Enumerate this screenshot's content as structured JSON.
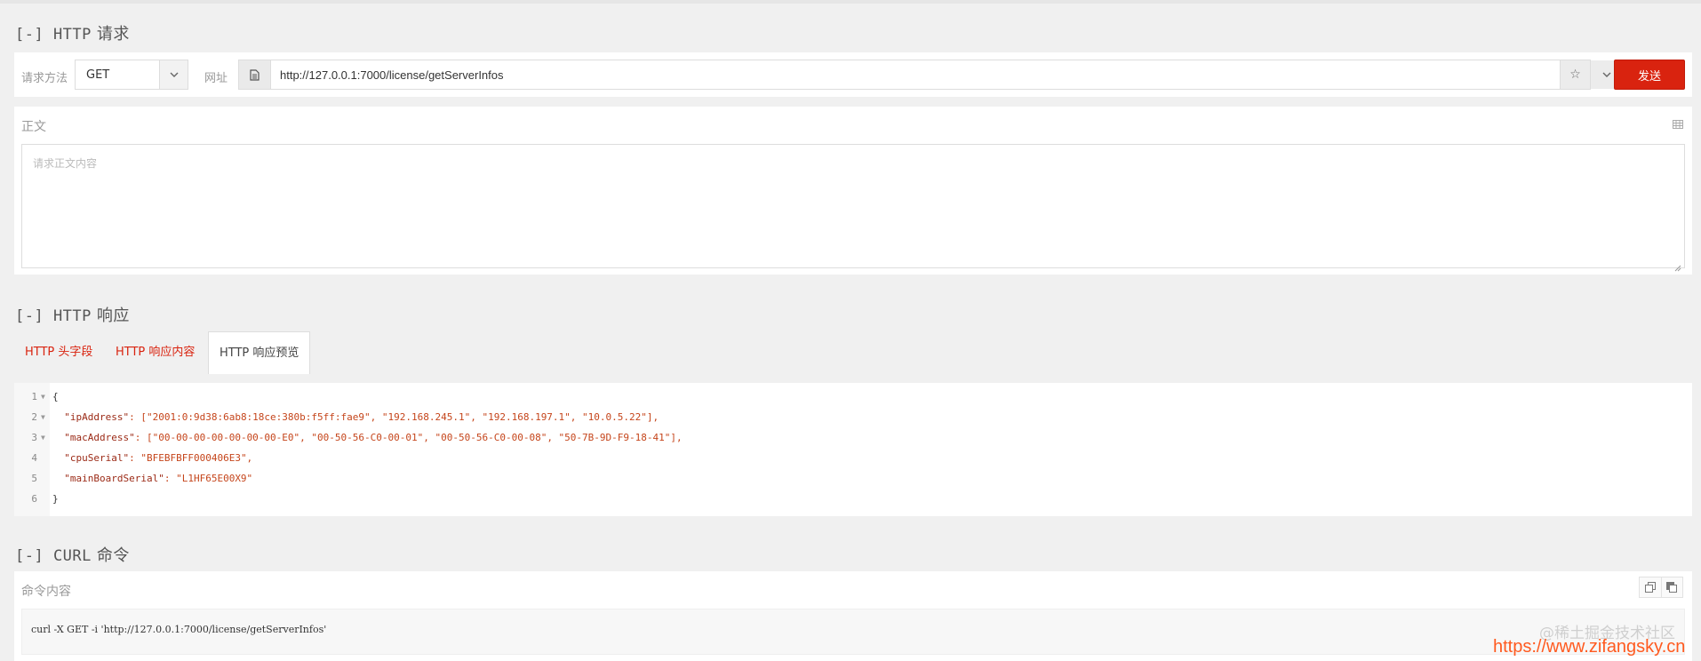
{
  "request_section": {
    "title_prefix": "[-] HTTP",
    "title_cn": "请求"
  },
  "request": {
    "method_label": "请求方法",
    "method_value": "GET",
    "url_label": "网址",
    "url_value": "http://127.0.0.1:7000/license/getServerInfos",
    "send_label": "发送"
  },
  "body": {
    "title": "正文",
    "placeholder": "请求正文内容"
  },
  "response_section": {
    "title_prefix": "[-] HTTP",
    "title_cn": "响应"
  },
  "tabs": [
    {
      "label": "HTTP 头字段"
    },
    {
      "label": "HTTP 响应内容"
    },
    {
      "label": "HTTP 响应预览",
      "active": true
    }
  ],
  "code_lines": [
    {
      "num": "1",
      "text": "{"
    },
    {
      "num": "2",
      "key": "\"ipAddress\"",
      "rest": ": [\"2001:0:9d38:6ab8:18ce:380b:f5ff:fae9\", \"192.168.245.1\", \"192.168.197.1\", \"10.0.5.22\"],"
    },
    {
      "num": "3",
      "key": "\"macAddress\"",
      "rest": ": [\"00-00-00-00-00-00-00-E0\", \"00-50-56-C0-00-01\", \"00-50-56-C0-00-08\", \"50-7B-9D-F9-18-41\"],"
    },
    {
      "num": "4",
      "key": "\"cpuSerial\"",
      "rest": ": \"BFEBFBFF000406E3\","
    },
    {
      "num": "5",
      "key": "\"mainBoardSerial\"",
      "rest": ": \"L1HF65E00X9\""
    },
    {
      "num": "6",
      "text": "}"
    }
  ],
  "curl_section": {
    "title_prefix": "[-] CURL",
    "title_cn": "命令"
  },
  "curl": {
    "title": "命令内容",
    "command": "curl -X GET -i 'http://127.0.0.1:7000/license/getServerInfos'"
  },
  "watermark": {
    "community": "@稀土掘金技术社区",
    "url": "https://www.zifangsky.cn"
  },
  "colors": {
    "accent": "#d9230f",
    "background": "#f0f0f0"
  }
}
